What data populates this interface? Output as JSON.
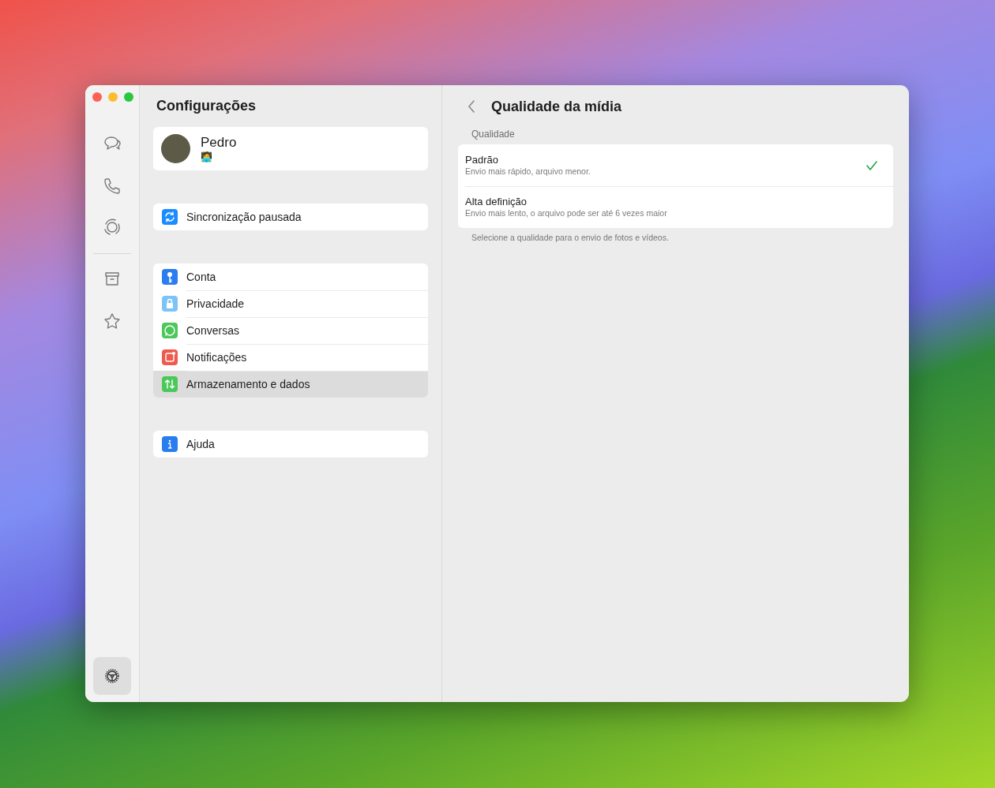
{
  "sidebar": {
    "groups": [
      [
        {
          "kind": "chats",
          "selected": false
        },
        {
          "kind": "calls",
          "selected": false
        },
        {
          "kind": "status",
          "selected": false
        }
      ],
      [
        {
          "kind": "archived",
          "selected": false
        },
        {
          "kind": "starred",
          "selected": false
        }
      ]
    ],
    "bottom_item": {
      "kind": "settings",
      "selected": true
    }
  },
  "settings": {
    "title": "Configurações",
    "profile": {
      "name": "Pedro",
      "status": "🧑‍💻"
    },
    "groups": [
      [
        {
          "label": "Sincronização pausada",
          "kind": "sync",
          "color": "#1a8cff",
          "selected": false
        }
      ],
      [
        {
          "label": "Conta",
          "kind": "key",
          "color": "#2a7df0",
          "selected": false
        },
        {
          "label": "Privacidade",
          "kind": "lock",
          "color": "#7cc4f5",
          "selected": false
        },
        {
          "label": "Conversas",
          "kind": "chat",
          "color": "#4cc85a",
          "selected": false
        },
        {
          "label": "Notificações",
          "kind": "notification",
          "color": "#ef5a4f",
          "selected": false
        },
        {
          "label": "Armazenamento e dados",
          "kind": "data",
          "color": "#4cc85a",
          "selected": true
        }
      ],
      [
        {
          "label": "Ajuda",
          "kind": "info",
          "color": "#2a7df0",
          "selected": false
        }
      ]
    ]
  },
  "detail": {
    "title": "Qualidade da mídia",
    "section": "Qualidade",
    "options": [
      {
        "title": "Padrão",
        "subtitle": "Envio mais rápido, arquivo menor.",
        "selected": true
      },
      {
        "title": "Alta definição",
        "subtitle": "Envio mais lento, o arquivo pode ser até 6 vezes maior",
        "selected": false
      }
    ],
    "footer": "Selecione a qualidade para o envio de fotos e vídeos."
  }
}
